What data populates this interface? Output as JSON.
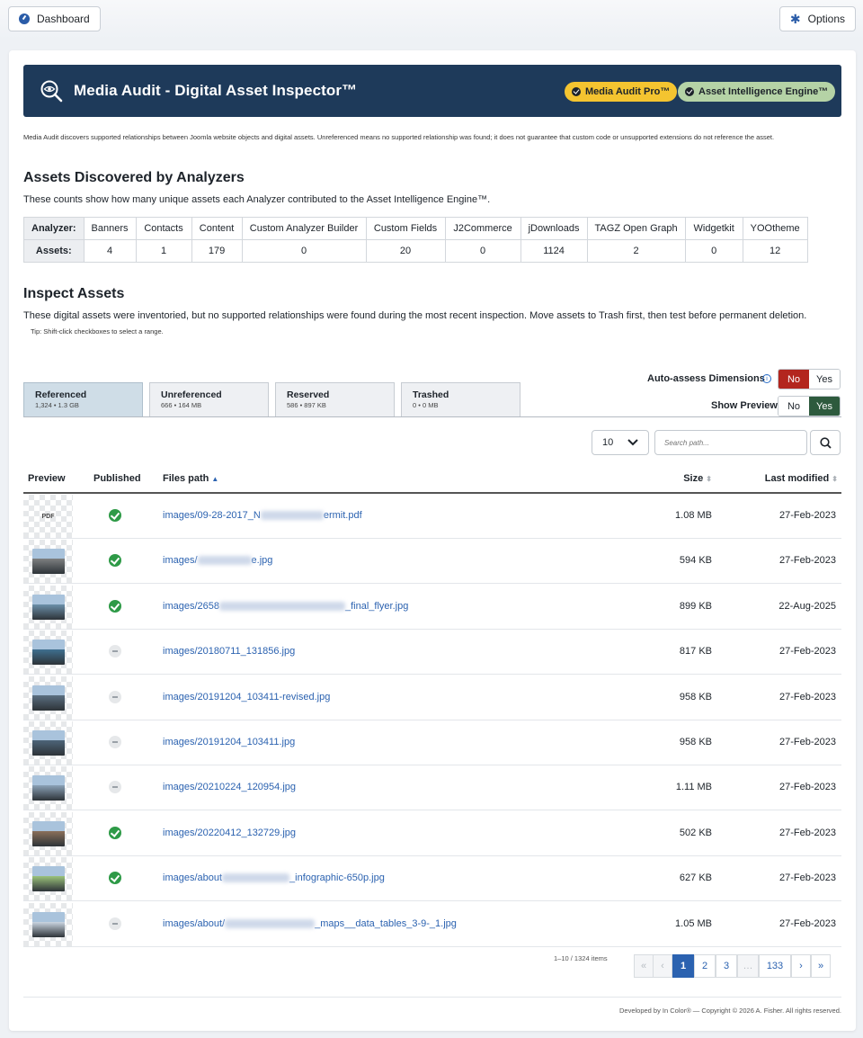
{
  "topbar": {
    "dashboard_label": "Dashboard",
    "options_label": "Options"
  },
  "hero": {
    "title": "Media Audit - Digital Asset Inspector™",
    "badge_pro": "Media Audit Pro™",
    "badge_engine": "Asset Intelligence Engine™",
    "badge_pro_color": "#f4c430",
    "badge_engine_color": "#b5d3a6"
  },
  "disclaimer": "Media Audit discovers supported relationships between Joomla website objects and digital assets. Unreferenced means no supported relationship was found; it does not guarantee that custom code or unsupported extensions do not reference the asset.",
  "analyzers": {
    "heading": "Assets Discovered by Analyzers",
    "description": "These counts show how many unique assets each Analyzer contributed to the Asset Intelligence Engine™.",
    "row_label_analyzer": "Analyzer:",
    "row_label_assets": "Assets:",
    "names": [
      "Banners",
      "Contacts",
      "Content",
      "Custom Analyzer Builder",
      "Custom Fields",
      "J2Commerce",
      "jDownloads",
      "TAGZ Open Graph",
      "Widgetkit",
      "YOOtheme"
    ],
    "counts": [
      "4",
      "1",
      "179",
      "0",
      "20",
      "0",
      "1124",
      "2",
      "0",
      "12"
    ]
  },
  "inspect": {
    "heading": "Inspect Assets",
    "description": "These digital assets were inventoried, but no supported relationships were found during the most recent inspection. Move assets to Trash first, then test before permanent deletion.",
    "tip": "Tip: Shift-click checkboxes to select a range."
  },
  "tabs": [
    {
      "label": "Referenced",
      "sub": "1,324 • 1.3 GB"
    },
    {
      "label": "Unreferenced",
      "sub": "666 • 164 MB"
    },
    {
      "label": "Reserved",
      "sub": "586 • 897 KB"
    },
    {
      "label": "Trashed",
      "sub": "0 • 0 MB"
    }
  ],
  "toggles": {
    "auto_assess_label": "Auto-assess Dimensions",
    "show_preview_label": "Show Preview",
    "no": "No",
    "yes": "Yes",
    "auto_assess_selected": "No",
    "show_preview_selected": "Yes"
  },
  "controls": {
    "per_page": "10",
    "search_placeholder": "Search path..."
  },
  "table": {
    "headers": {
      "preview": "Preview",
      "published": "Published",
      "path": "Files path",
      "size": "Size",
      "modified": "Last modified"
    },
    "rows": [
      {
        "preview": "PDF",
        "published": true,
        "path_a": "images/09-28-2017_N",
        "path_b": "ermit.pdf",
        "size": "1.08 MB",
        "modified": "27-Feb-2023"
      },
      {
        "preview": "image",
        "published": true,
        "path_a": "images/",
        "path_b": "e.jpg",
        "size": "594 KB",
        "modified": "27-Feb-2023"
      },
      {
        "preview": "image",
        "published": true,
        "path_a": "images/2658",
        "path_b": "_final_flyer.jpg",
        "size": "899 KB",
        "modified": "22-Aug-2025"
      },
      {
        "preview": "image",
        "published": false,
        "path_a": "images/20180711_131856.jpg",
        "path_b": "",
        "size": "817 KB",
        "modified": "27-Feb-2023"
      },
      {
        "preview": "image",
        "published": false,
        "path_a": "images/20191204_103411-revised.jpg",
        "path_b": "",
        "size": "958 KB",
        "modified": "27-Feb-2023"
      },
      {
        "preview": "image",
        "published": false,
        "path_a": "images/20191204_103411.jpg",
        "path_b": "",
        "size": "958 KB",
        "modified": "27-Feb-2023"
      },
      {
        "preview": "image",
        "published": false,
        "path_a": "images/20210224_120954.jpg",
        "path_b": "",
        "size": "1.11 MB",
        "modified": "27-Feb-2023"
      },
      {
        "preview": "image",
        "published": true,
        "path_a": "images/20220412_132729.jpg",
        "path_b": "",
        "size": "502 KB",
        "modified": "27-Feb-2023"
      },
      {
        "preview": "image",
        "published": true,
        "path_a": "images/about",
        "path_b": "_infographic-650p.jpg",
        "size": "627 KB",
        "modified": "27-Feb-2023"
      },
      {
        "preview": "image",
        "published": false,
        "path_a": "images/about/",
        "path_b": "_maps__data_tables_3-9-_1.jpg",
        "size": "1.05 MB",
        "modified": "27-Feb-2023"
      }
    ]
  },
  "pagination": {
    "info": "1–10 / 1324 items",
    "first": "«",
    "prev": "‹",
    "pages": [
      "1",
      "2",
      "3"
    ],
    "ellipsis": "…",
    "last_page": "133",
    "next": "›",
    "last": "»",
    "current": "1"
  },
  "footer": "Developed by In Color® — Copyright © 2026 A. Fisher. All rights reserved."
}
